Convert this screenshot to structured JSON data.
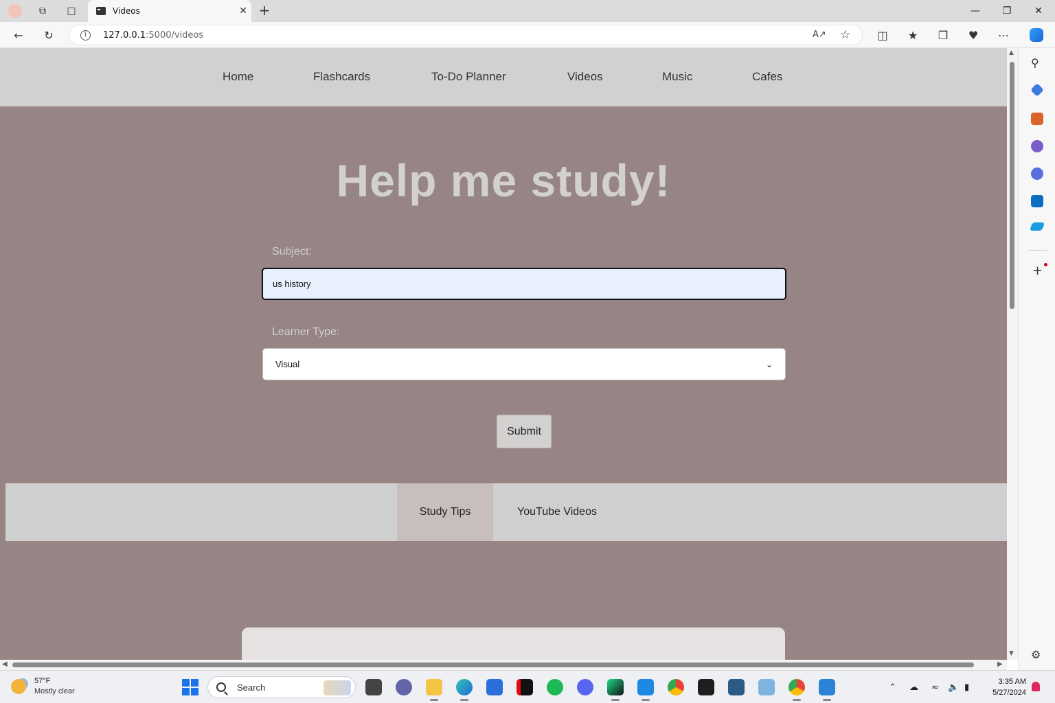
{
  "browser": {
    "tab_title": "Videos",
    "url_host": "127.0.0.1",
    "url_rest": ":5000/videos"
  },
  "site_nav": {
    "items": [
      "Home",
      "Flashcards",
      "To-Do Planner",
      "Videos",
      "Music",
      "Cafes"
    ]
  },
  "hero": {
    "title": "Help me study!"
  },
  "form": {
    "subject_label": "Subject:",
    "subject_value": "us history",
    "learner_label": "Learner Type:",
    "learner_value": "Visual",
    "submit_label": "Submit"
  },
  "tabs": {
    "items": [
      "Study Tips",
      "YouTube Videos"
    ],
    "active": "Study Tips"
  },
  "taskbar": {
    "weather_temp": "57°F",
    "weather_desc": "Mostly clear",
    "search_placeholder": "Search",
    "time": "3:35 AM",
    "date": "5/27/2024"
  },
  "colors": {
    "page_bg": "#968584",
    "nav_bg": "#d3d0d0",
    "hero_text": "#d3d0d0",
    "tabs_bg": "#cfcfcf",
    "active_tab": "#c8bebe",
    "input_bg": "#e8f0fe"
  }
}
